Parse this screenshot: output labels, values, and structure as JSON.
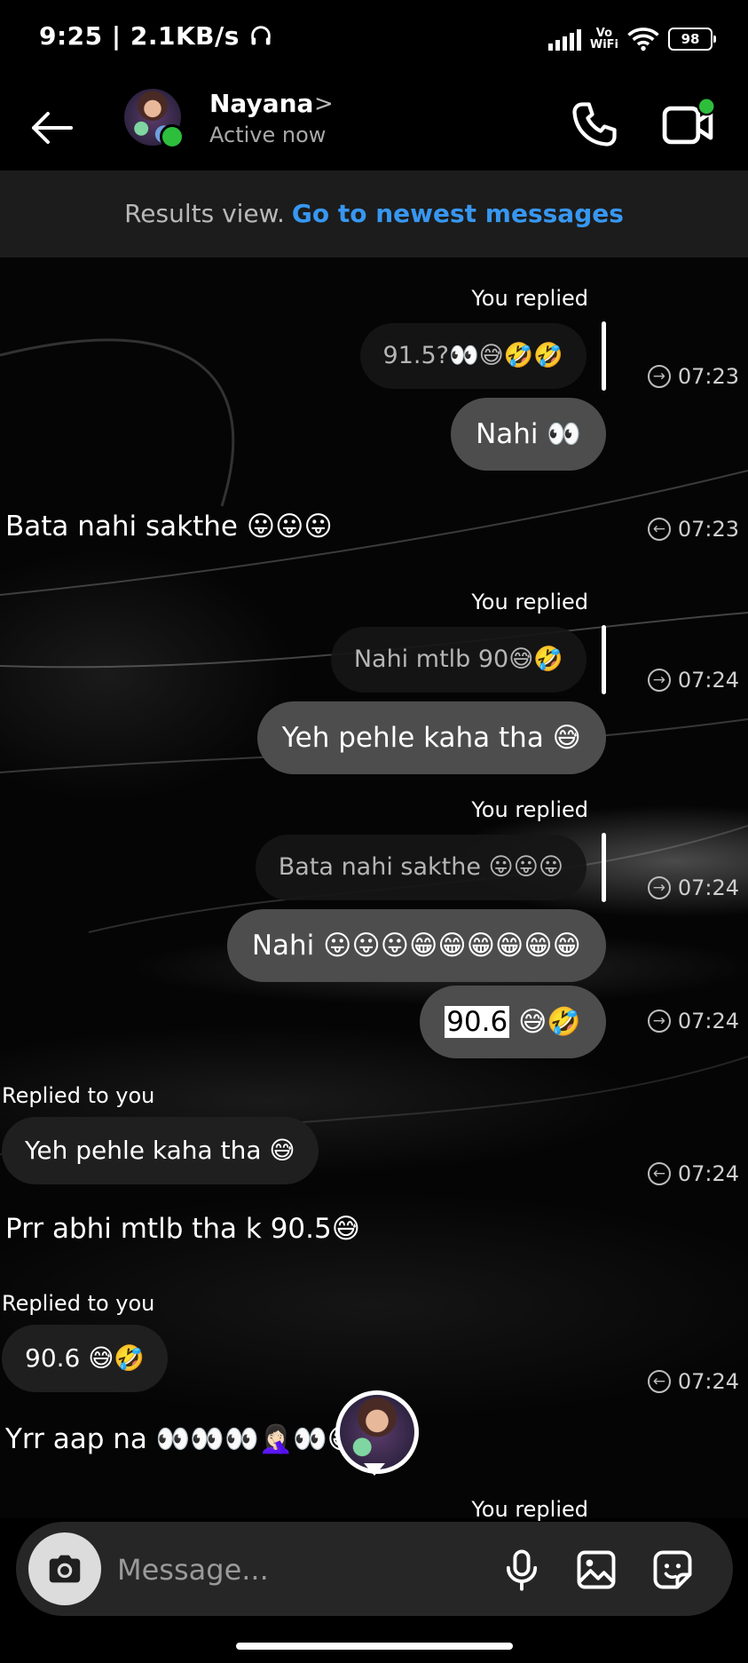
{
  "status_bar": {
    "left": "9:25 | 2.1KB/s",
    "vowifi_top": "Vo",
    "vowifi_bottom": "WiFi",
    "battery": "98"
  },
  "header": {
    "name": "Nayana",
    "status": "Active now",
    "chevron": ">"
  },
  "banner": {
    "text": "Results view.",
    "link": "Go to newest messages"
  },
  "messages": {
    "m1_label": "You replied",
    "m1_quote": "91.5?👀😅🤣🤣",
    "m1_text": "Nahi 👀",
    "m1_time": "07:23",
    "m2_text": "Bata nahi sakthe 😛😛😛",
    "m2_time": "07:23",
    "m3_label": "You replied",
    "m3_quote": "Nahi mtlb 90😅🤣",
    "m3_text": "Yeh pehle kaha tha 😅",
    "m3_time": "07:24",
    "m4_label": "You replied",
    "m4_quote": "Bata nahi sakthe 😛😛😛",
    "m4_text": "Nahi 😛😛😛😁😁😁😁😁😁",
    "m4_time": "07:24",
    "m5_num": "90.6",
    "m5_emoji": " 😅🤣",
    "m5_time": "07:24",
    "m6_label": "Replied to you",
    "m6_quote": "Yeh pehle kaha tha 😅",
    "m6_text": "Prr abhi mtlb tha k 90.5😅",
    "m6_time": "07:24",
    "m7_label": "Replied to you",
    "m7_quote": "90.6 😅🤣",
    "m7_text": "Yrr aap na 👀👀👀🤦🏻‍♀️👀😅",
    "m7_time": "07:24",
    "m8_label": "You replied"
  },
  "composer": {
    "placeholder": "Message..."
  },
  "colors": {
    "link_blue": "#3797f0",
    "online_green": "#2dbe3c",
    "outgoing_bubble": "#4d4d4d",
    "banner_bg": "#1c1c1c"
  },
  "icons": [
    "back-arrow-icon",
    "phone-icon",
    "video-camera-icon",
    "camera-icon",
    "microphone-icon",
    "gallery-icon",
    "sticker-icon",
    "forward-arrow-icon",
    "reply-arrow-icon",
    "headphones-icon",
    "signal-icon",
    "wifi-icon",
    "battery-icon"
  ]
}
